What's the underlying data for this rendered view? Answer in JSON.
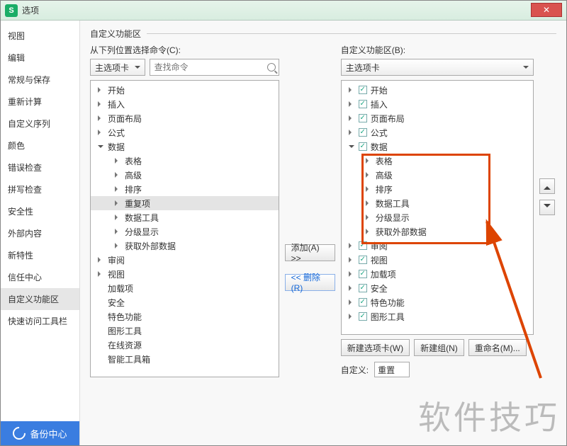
{
  "window_title": "选项",
  "sidebar": {
    "items": [
      "视图",
      "编辑",
      "常规与保存",
      "重新计算",
      "自定义序列",
      "颜色",
      "错误检查",
      "拼写检查",
      "安全性",
      "外部内容",
      "新特性",
      "信任中心",
      "自定义功能区",
      "快速访问工具栏"
    ],
    "active_index": 12,
    "backup_label": "备份中心"
  },
  "section": {
    "title": "自定义功能区"
  },
  "left": {
    "label": "从下列位置选择命令(C):",
    "combo": "主选项卡",
    "search_placeholder": "查找命令",
    "tree": [
      {
        "t": "开始",
        "d": 0,
        "exp": false
      },
      {
        "t": "插入",
        "d": 0,
        "exp": false
      },
      {
        "t": "页面布局",
        "d": 0,
        "exp": false
      },
      {
        "t": "公式",
        "d": 0,
        "exp": false
      },
      {
        "t": "数据",
        "d": 0,
        "exp": true,
        "children": [
          {
            "t": "表格",
            "d": 1
          },
          {
            "t": "高级",
            "d": 1
          },
          {
            "t": "排序",
            "d": 1
          },
          {
            "t": "重复项",
            "d": 1,
            "sel": true
          },
          {
            "t": "数据工具",
            "d": 1
          },
          {
            "t": "分级显示",
            "d": 1
          },
          {
            "t": "获取外部数据",
            "d": 1
          }
        ]
      },
      {
        "t": "审阅",
        "d": 0,
        "exp": false
      },
      {
        "t": "视图",
        "d": 0,
        "exp": false
      },
      {
        "t": "加载项",
        "d": 0,
        "noicon": true
      },
      {
        "t": "安全",
        "d": 0,
        "noicon": true
      },
      {
        "t": "特色功能",
        "d": 0,
        "noicon": true
      },
      {
        "t": "图形工具",
        "d": 0,
        "noicon": true
      },
      {
        "t": "在线资源",
        "d": 0,
        "noicon": true
      },
      {
        "t": "智能工具箱",
        "d": 0,
        "noicon": true
      }
    ]
  },
  "mid": {
    "add": "添加(A) >>",
    "remove": "<< 删除(R)"
  },
  "right": {
    "label": "自定义功能区(B):",
    "combo": "主选项卡",
    "tree": [
      {
        "t": "开始",
        "chk": true
      },
      {
        "t": "插入",
        "chk": true
      },
      {
        "t": "页面布局",
        "chk": true
      },
      {
        "t": "公式",
        "chk": true
      },
      {
        "t": "数据",
        "chk": true,
        "exp": true,
        "children": [
          {
            "t": "表格"
          },
          {
            "t": "高级"
          },
          {
            "t": "排序"
          },
          {
            "t": "数据工具"
          },
          {
            "t": "分级显示"
          },
          {
            "t": "获取外部数据"
          }
        ]
      },
      {
        "t": "审阅",
        "chk": true
      },
      {
        "t": "视图",
        "chk": true
      },
      {
        "t": "加载项",
        "chk": true
      },
      {
        "t": "安全",
        "chk": true
      },
      {
        "t": "特色功能",
        "chk": true
      },
      {
        "t": "图形工具",
        "chk": true
      }
    ],
    "buttons": {
      "newtab": "新建选项卡(W)",
      "newgroup": "新建组(N)",
      "rename": "重命名(M)..."
    },
    "custom_label": "自定义:",
    "custom_value": "重置"
  },
  "watermark": "软件技巧"
}
